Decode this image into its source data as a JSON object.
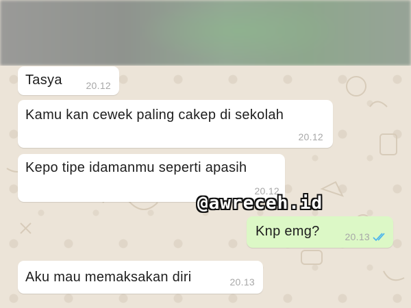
{
  "messages": [
    {
      "direction": "in",
      "text": "Tasya",
      "time": "20.12"
    },
    {
      "direction": "in",
      "text": "Kamu kan cewek paling cakep di sekolah",
      "time": "20.12"
    },
    {
      "direction": "in",
      "text": "Kepo tipe idamanmu seperti apasih",
      "time": "20.12"
    },
    {
      "direction": "out",
      "text": "Knp emg?",
      "time": "20.13",
      "status": "read-double-tick-icon"
    },
    {
      "direction": "in",
      "text": "Aku mau memaksakan diri",
      "time": "20.13"
    }
  ],
  "watermark": "@awreceh.id",
  "colors": {
    "chat_background": "#ece4d8",
    "incoming_bubble": "#ffffff",
    "outgoing_bubble": "#dcf8c6",
    "read_tick": "#4fb6ec",
    "timestamp": "#a7a7a7"
  }
}
